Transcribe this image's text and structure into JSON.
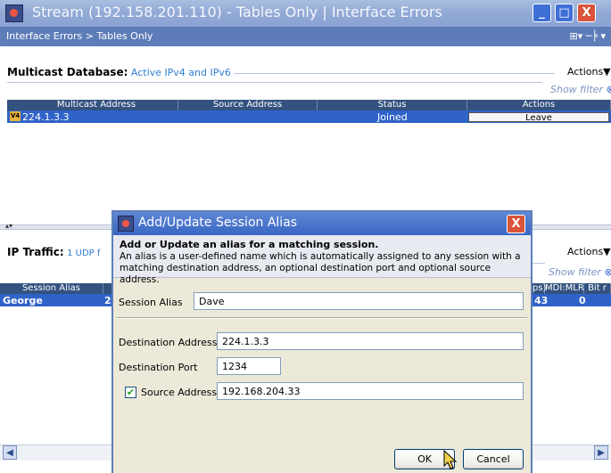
{
  "window": {
    "title": "Stream (192.158.201.110) - Tables Only | Interface Errors",
    "minimize": "_",
    "maximize": "□",
    "close": "X"
  },
  "breadcrumb": {
    "text": "Interface Errors > Tables Only",
    "icons": "⊞▾ ─╞ ▾"
  },
  "multicast": {
    "title": "Multicast Database:",
    "subtitle": "Active IPv4 and IPv6",
    "actions_label": "Actions▼",
    "show_filter": "Show filter",
    "columns": [
      "Multicast Address",
      "Source Address",
      "Status",
      "Actions"
    ],
    "rows": [
      {
        "badge": "V4",
        "address": "224.1.3.3",
        "source": "",
        "status": "Joined",
        "action": "Leave"
      }
    ]
  },
  "ip_traffic": {
    "title": "IP Traffic:",
    "subtitle": "1 UDP f",
    "actions_label": "Actions▼",
    "show_filter": "Show filter",
    "columns_left": [
      "Session Alias"
    ],
    "columns_right": [
      "ps)",
      "MDI:MLR",
      "Bit r"
    ],
    "row": {
      "alias": "George",
      "col2": "2",
      "right1": "43",
      "right2": "0"
    }
  },
  "dialog": {
    "title": "Add/Update Session Alias",
    "close": "X",
    "heading": "Add or Update an alias for a matching session.",
    "description": "An alias is a user-defined name which is automatically assigned to any session with a matching destination address, an optional destination port and optional source address.",
    "session_alias_label": "Session Alias",
    "session_alias_value": "Dave",
    "dest_address_label": "Destination Address",
    "dest_address_value": "224.1.3.3",
    "dest_port_label": "Destination Port",
    "dest_port_value": "1234",
    "source_address_label": "Source Address",
    "source_address_value": "192.168.204.33",
    "source_checked": "✔",
    "ok_label": "OK",
    "cancel_label": "Cancel"
  },
  "colors": {
    "title_bar": "#93aad6",
    "breadcrumb_bar": "#5e7db8",
    "grid_header": "#33527f",
    "selected_row": "#3063c8",
    "dialog_title": "#3a66c4"
  }
}
